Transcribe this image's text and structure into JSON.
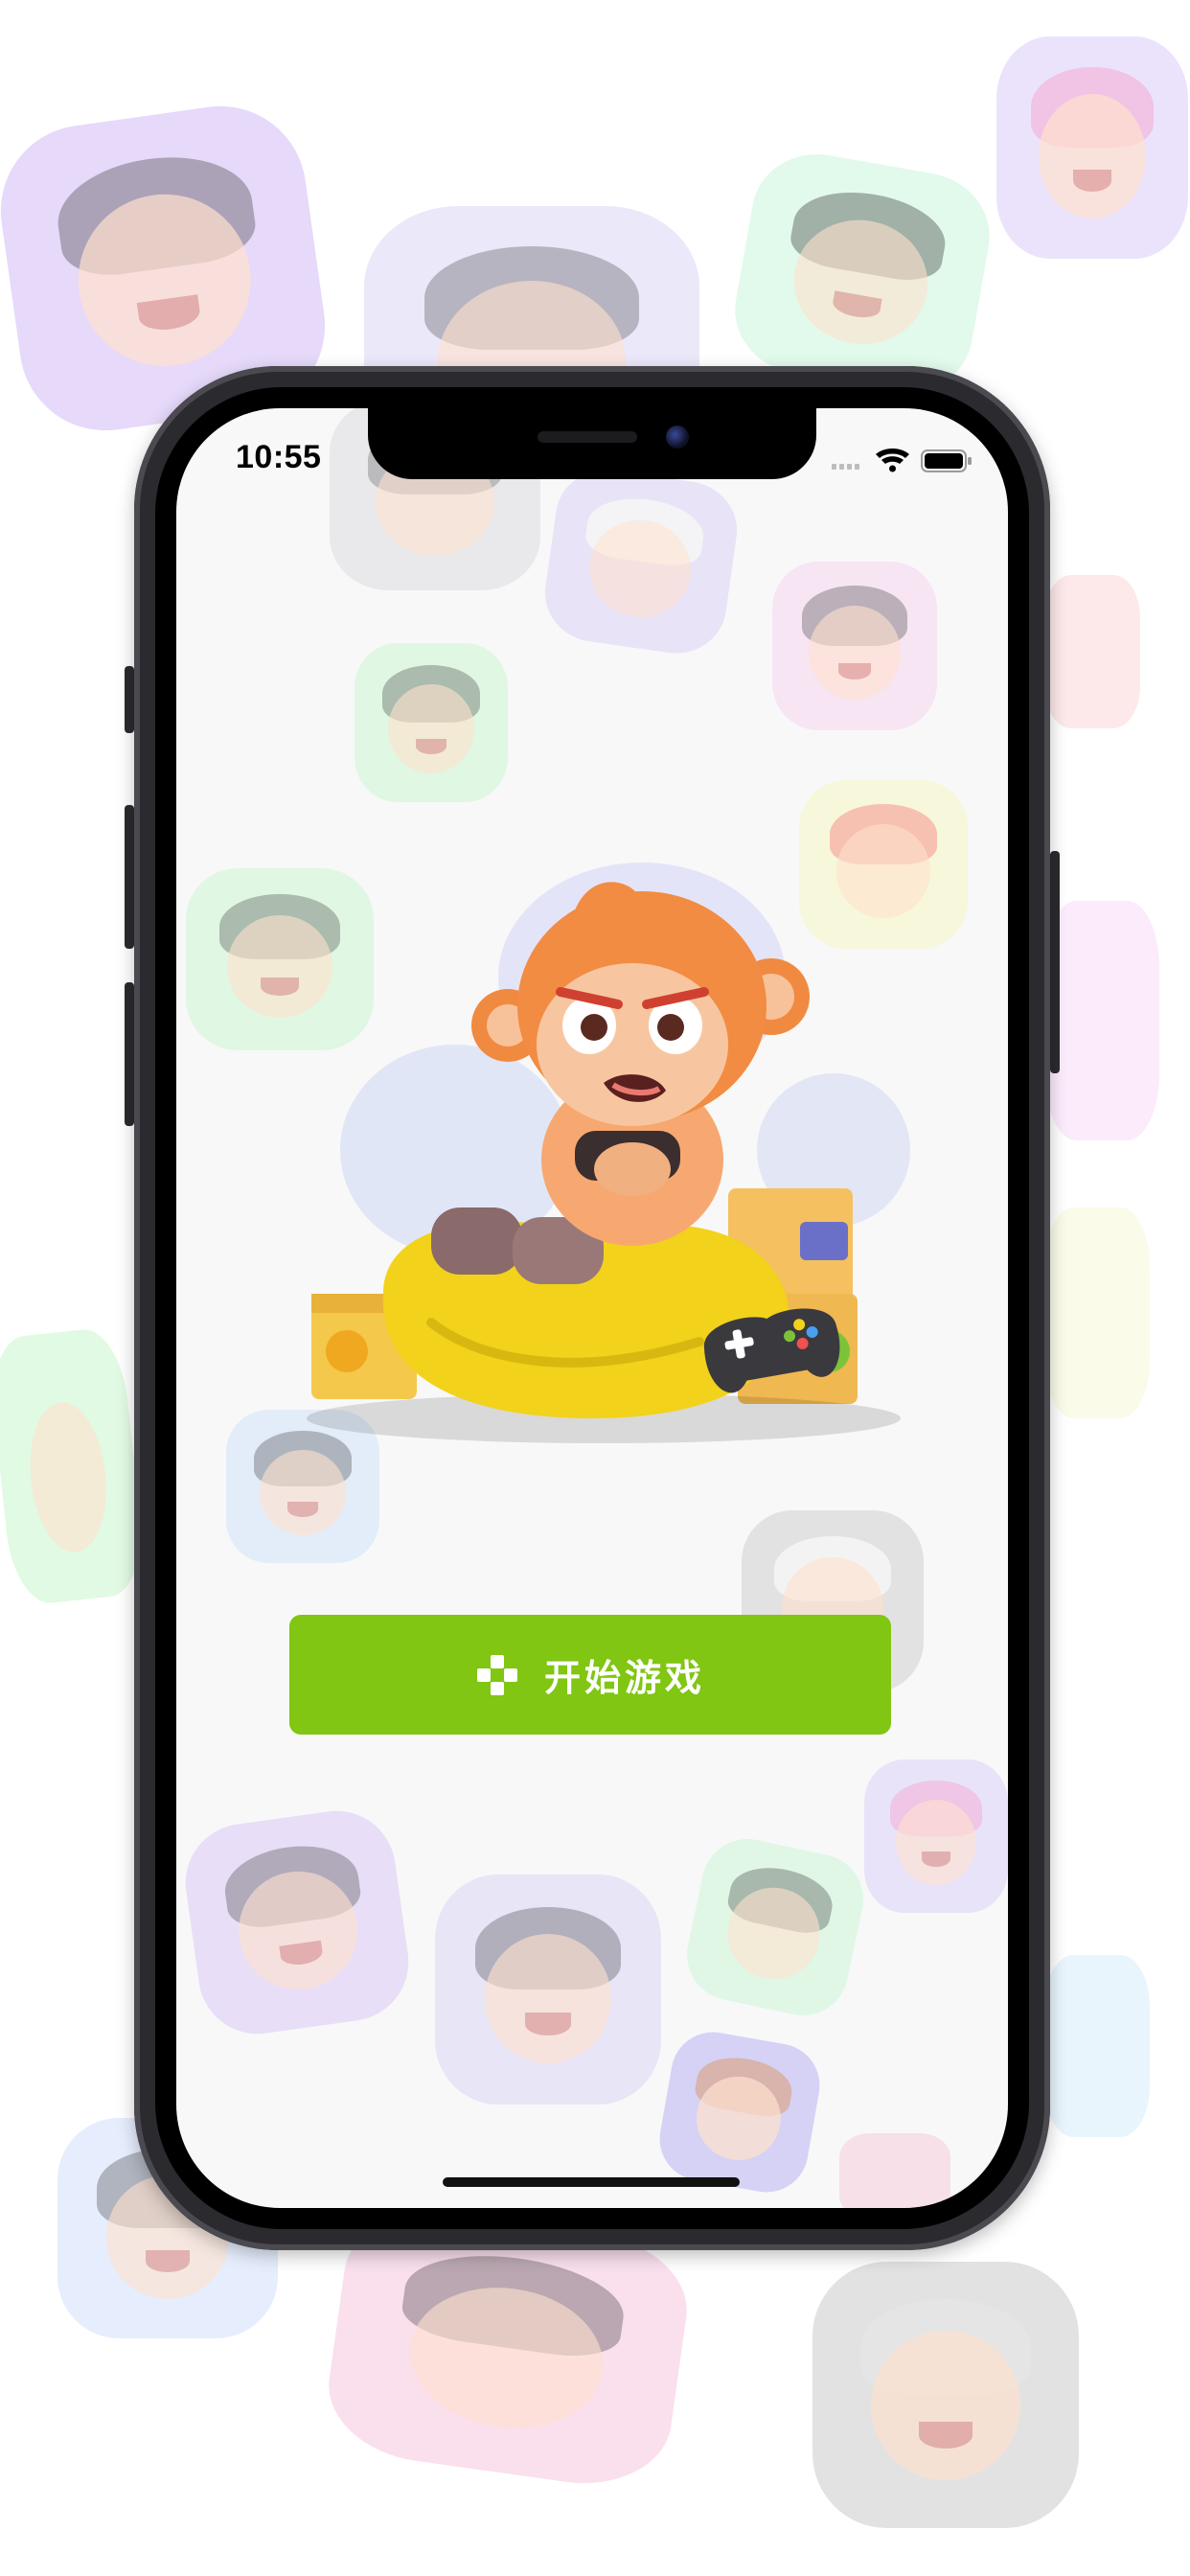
{
  "status_bar": {
    "time": "10:55",
    "signal_icon": "cellular-signal-icon",
    "wifi_icon": "wifi-icon",
    "battery_icon": "battery-icon"
  },
  "main": {
    "start_button_label": "开始游戏",
    "start_button_icon": "gamepad-cross-icon",
    "mascot": "monkey-gamer-illustration"
  },
  "colors": {
    "accent": "#80c612",
    "screen_bg": "#f8f8f8",
    "frame": "#2b2b2f"
  }
}
